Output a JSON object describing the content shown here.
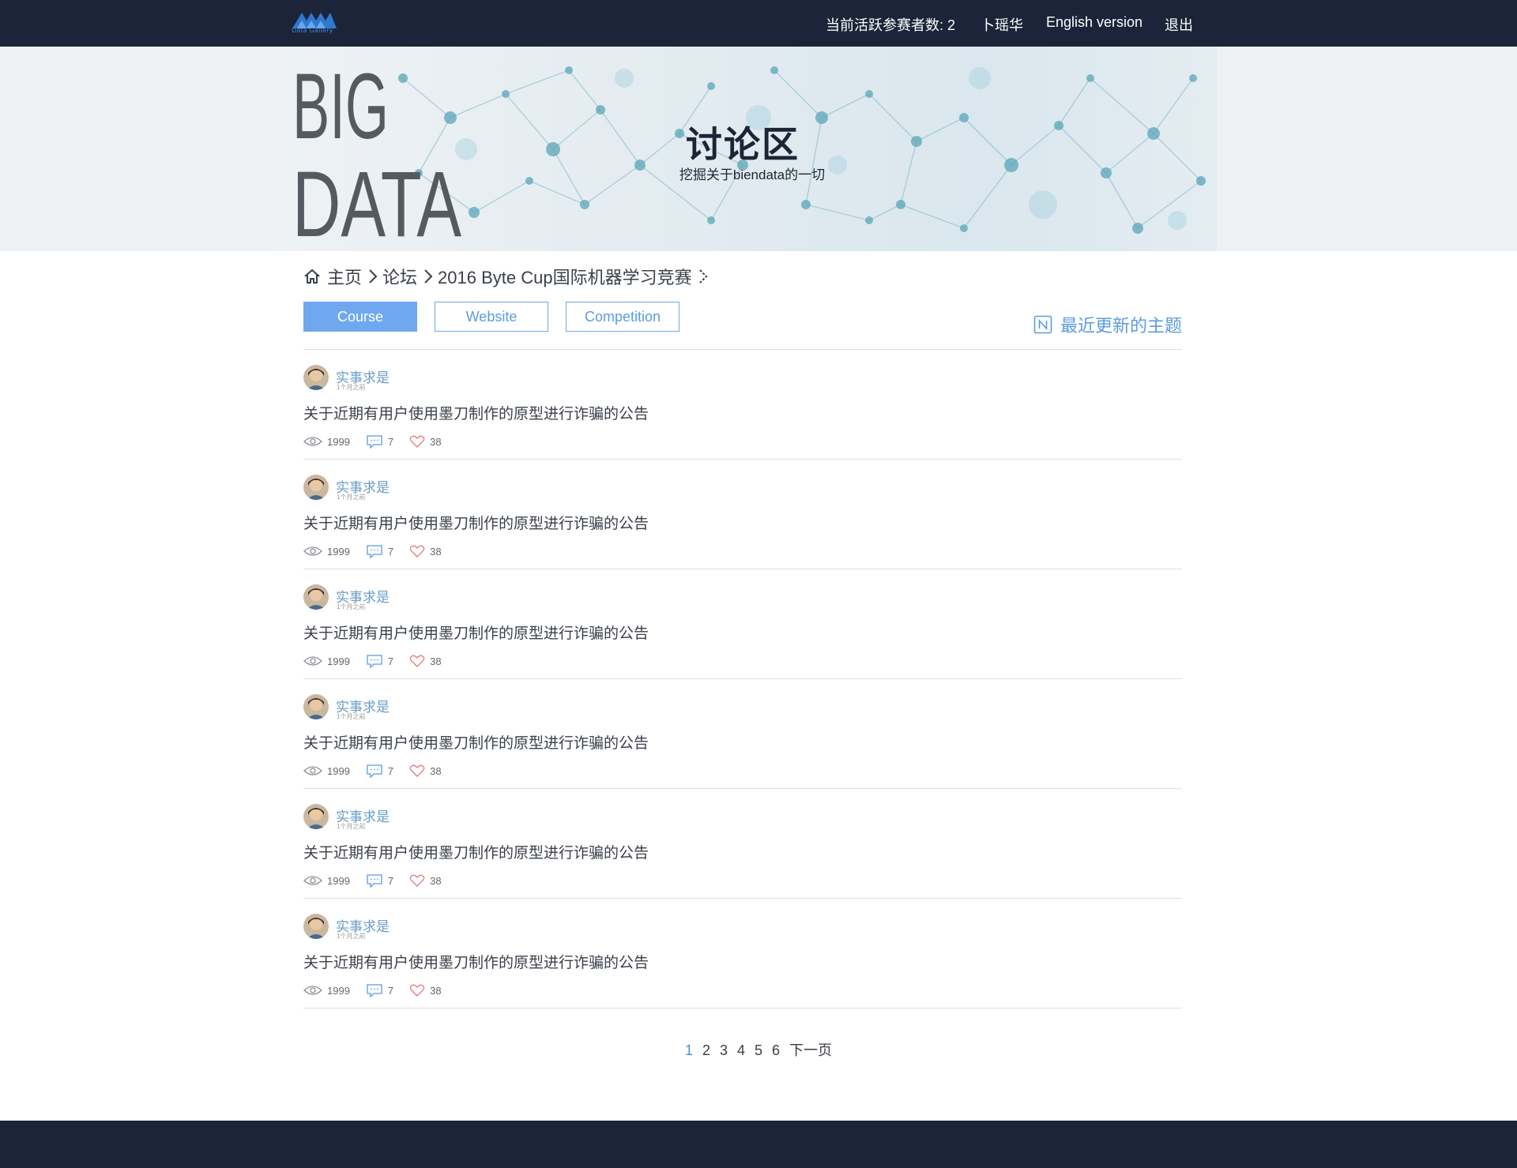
{
  "header": {
    "logo_text": "Data Gallery",
    "active_count_label": "当前活跃参赛者数: 2",
    "user_name": "卜瑶华",
    "english_link": "English version",
    "logout_link": "退出"
  },
  "banner": {
    "image_text_line1": "BIG",
    "image_text_line2": "DATA",
    "title": "讨论区",
    "subtitle": "挖掘关于biendata的一切"
  },
  "breadcrumb": {
    "home": "主页",
    "forum": "论坛",
    "competition": "2016 Byte Cup国际机器学习竞赛"
  },
  "tabs": [
    {
      "label": "Course",
      "active": true
    },
    {
      "label": "Website",
      "active": false
    },
    {
      "label": "Competition",
      "active": false
    }
  ],
  "recent_topics_label": "最近更新的主题",
  "posts": [
    {
      "author": "实事求是",
      "time": "1个月之前",
      "title": "关于近期有用户使用墨刀制作的原型进行诈骗的公告",
      "views": "1999",
      "comments": "7",
      "likes": "38"
    },
    {
      "author": "实事求是",
      "time": "1个月之前",
      "title": "关于近期有用户使用墨刀制作的原型进行诈骗的公告",
      "views": "1999",
      "comments": "7",
      "likes": "38"
    },
    {
      "author": "实事求是",
      "time": "1个月之前",
      "title": "关于近期有用户使用墨刀制作的原型进行诈骗的公告",
      "views": "1999",
      "comments": "7",
      "likes": "38"
    },
    {
      "author": "实事求是",
      "time": "1个月之前",
      "title": "关于近期有用户使用墨刀制作的原型进行诈骗的公告",
      "views": "1999",
      "comments": "7",
      "likes": "38"
    },
    {
      "author": "实事求是",
      "time": "1个月之前",
      "title": "关于近期有用户使用墨刀制作的原型进行诈骗的公告",
      "views": "1999",
      "comments": "7",
      "likes": "38"
    },
    {
      "author": "实事求是",
      "time": "1个月之前",
      "title": "关于近期有用户使用墨刀制作的原型进行诈骗的公告",
      "views": "1999",
      "comments": "7",
      "likes": "38"
    }
  ],
  "pagination": {
    "pages": [
      "1",
      "2",
      "3",
      "4",
      "5",
      "6"
    ],
    "current": "1",
    "next_label": "下一页"
  },
  "colors": {
    "navbar": "#1b2438",
    "accent": "#5b9be0",
    "active_tab": "#6fa8ef",
    "author": "#6a9cc4",
    "like_icon": "#e8747c"
  }
}
